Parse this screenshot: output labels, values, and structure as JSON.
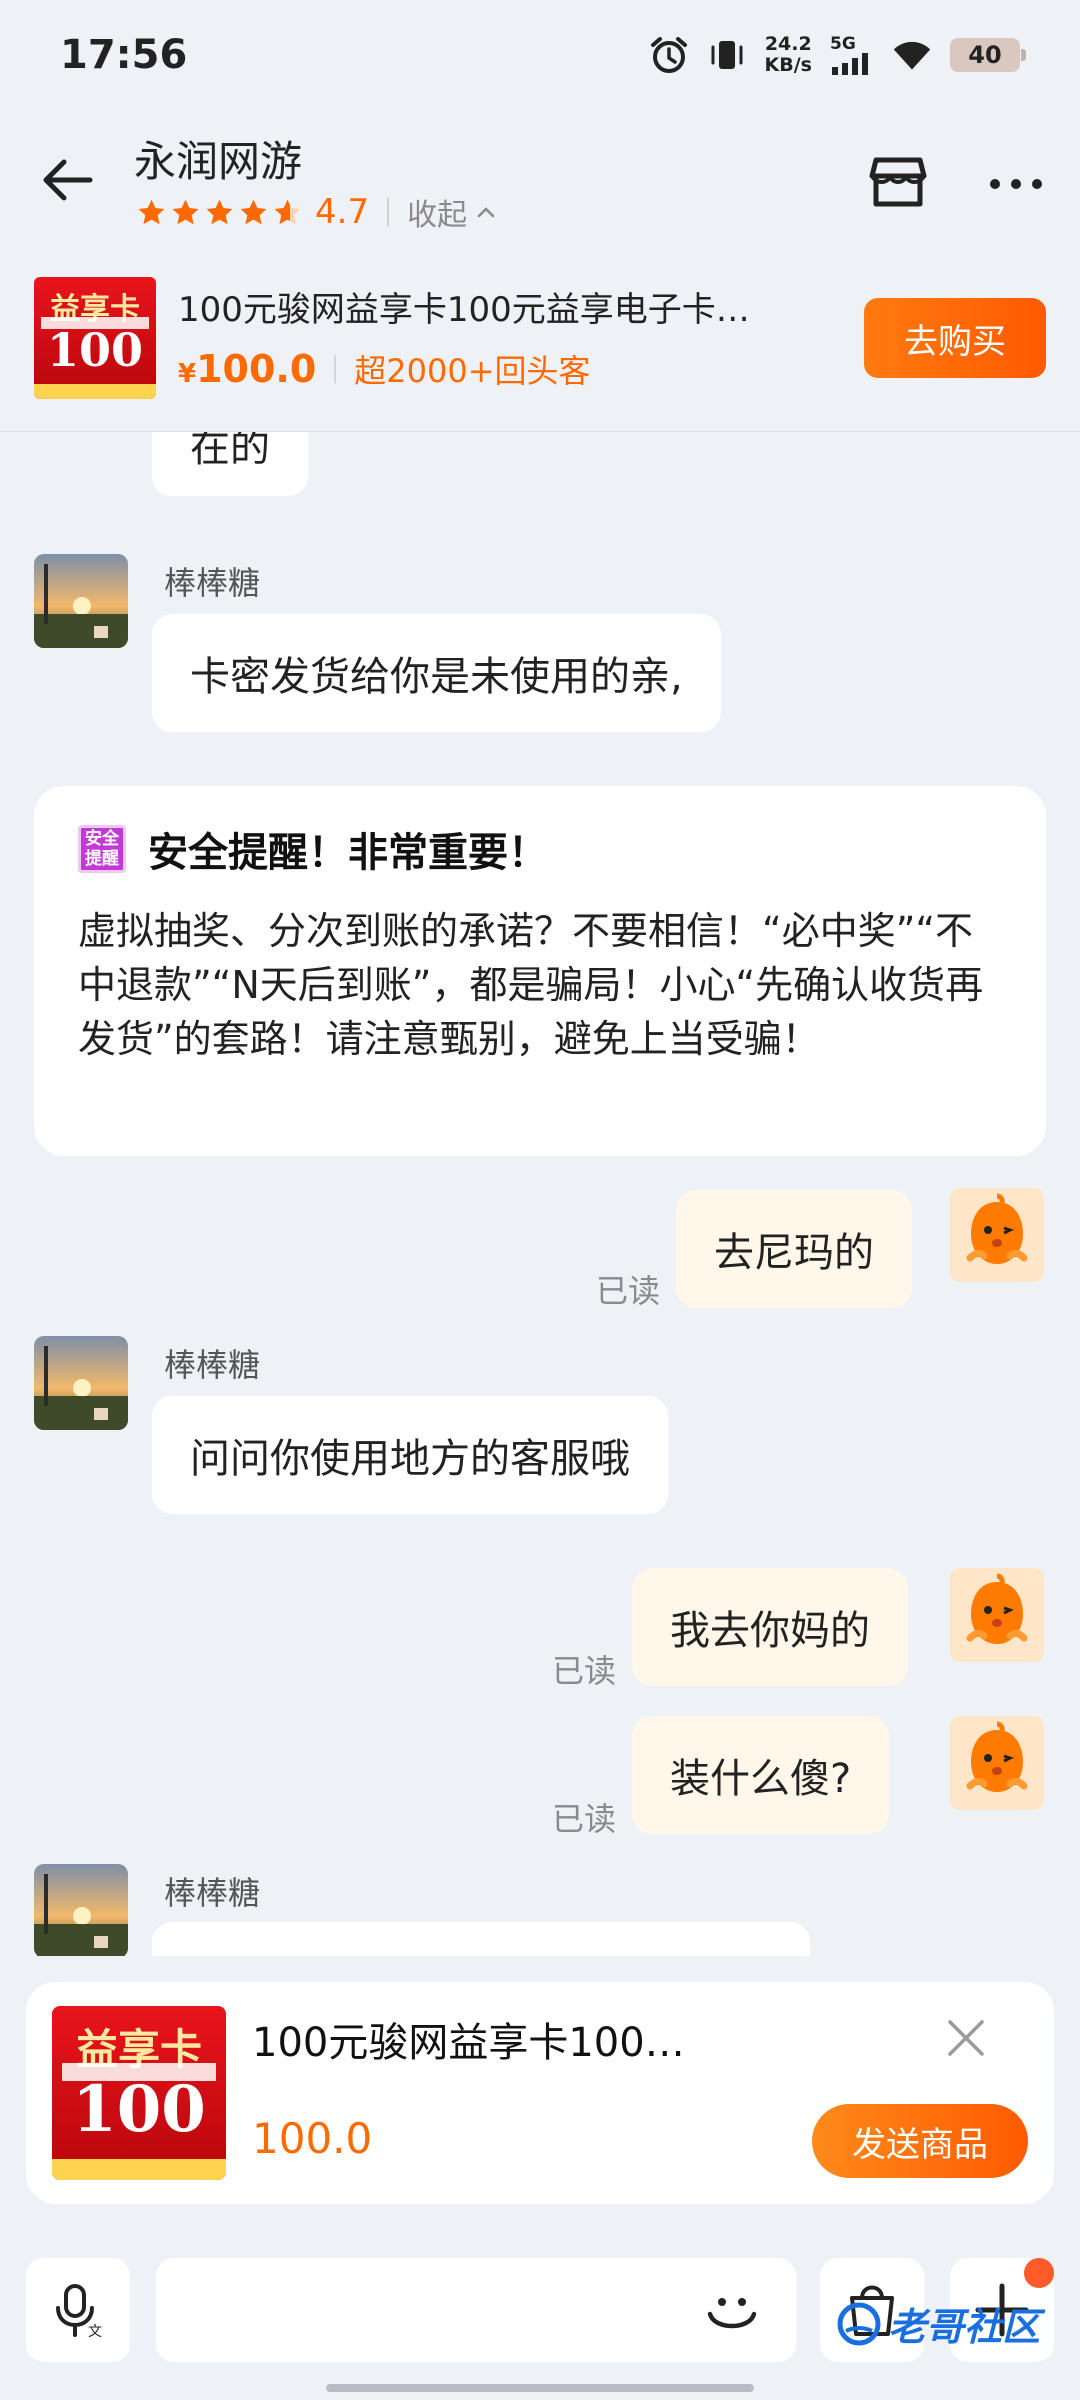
{
  "status_bar": {
    "time": "17:56",
    "net_speed_value": "24.2",
    "net_speed_unit": "KB/s",
    "network": "5G",
    "battery": "40"
  },
  "header": {
    "shop_name": "永润网游",
    "rating": "4.7",
    "rating_stars": 4.7,
    "collapse_label": "收起"
  },
  "product": {
    "title": "100元骏网益享卡100元益享电子卡…",
    "price_symbol": "¥",
    "price": "100.0",
    "repeat_customers": "超2000+回头客",
    "buy_label": "去购买",
    "card_top_text": "益享卡",
    "card_value_text": "100"
  },
  "messages": {
    "m1": "在的",
    "sender_1": "棒棒糖",
    "m2": "卡密发货给你是未使用的亲,",
    "warning": {
      "badge": "安全提醒",
      "title": "安全提醒！非常重要！",
      "body": "虚拟抽奖、分次到账的承诺？不要相信！“必中奖”“不中退款”“N天后到账”，都是骗局！小心“先确认收货再发货”的套路！请注意甄别，避免上当受骗！"
    },
    "m3": "去尼玛的",
    "read_1": "已读",
    "sender_2": "棒棒糖",
    "m4": "问问你使用地方的客服哦",
    "m5": "我去你妈的",
    "read_2": "已读",
    "m6": "装什么傻?",
    "read_3": "已读",
    "sender_3": "棒棒糖"
  },
  "send_card": {
    "title": "100元骏网益享卡100…",
    "price": "100.0",
    "send_label": "发送商品"
  },
  "watermark": "老哥社区",
  "colors": {
    "accent": "#ff6a00",
    "background": "#eef1f6",
    "my_bubble": "#fff7e9"
  }
}
